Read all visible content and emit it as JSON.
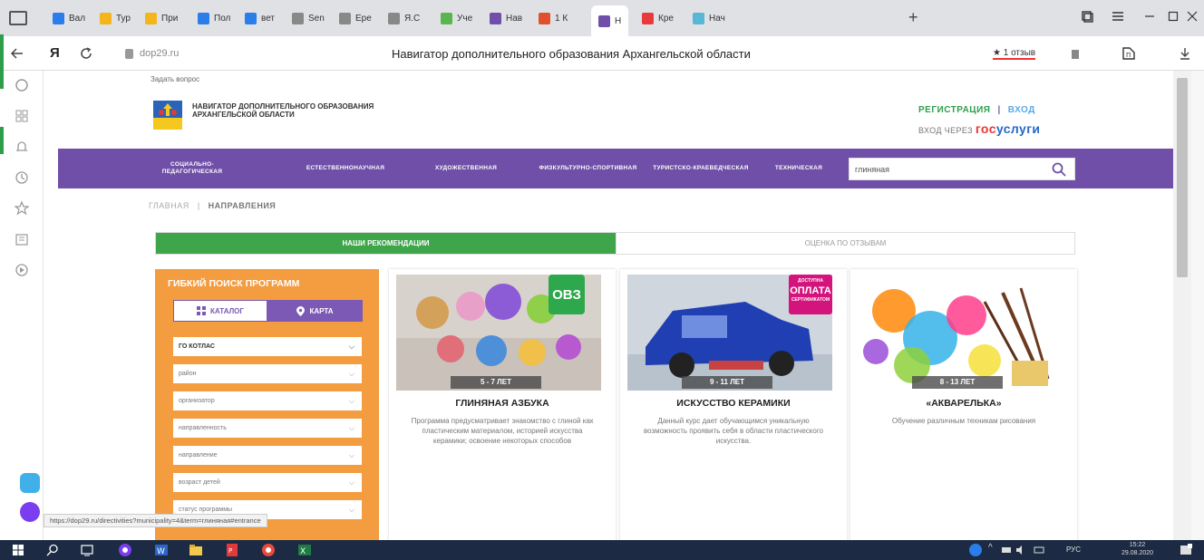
{
  "browser": {
    "tabs": [
      {
        "label": "Вал",
        "color": "#2b7de9"
      },
      {
        "label": "Тур",
        "color": "#f3b51b"
      },
      {
        "label": "При",
        "color": "#f3b51b"
      },
      {
        "label": "Пол",
        "color": "#2b7de9"
      },
      {
        "label": "вет",
        "color": "#2b7de9"
      },
      {
        "label": "Sen",
        "color": "#888888"
      },
      {
        "label": "Ере",
        "color": "#888888"
      },
      {
        "label": "Я.С",
        "color": "#888888"
      },
      {
        "label": "Уче",
        "color": "#59b64e"
      },
      {
        "label": "Нав",
        "color": "#6f4fa7"
      },
      {
        "label": "1 К",
        "color": "#e0502f"
      },
      {
        "label": "Н",
        "color": "#6f4fa7"
      },
      {
        "label": "Кре",
        "color": "#e83a3a"
      },
      {
        "label": "Нач",
        "color": "#58b7d7"
      }
    ],
    "new_tab": "+",
    "url": "dop29.ru",
    "page_title": "Навигатор дополнительного образования Архангельской области",
    "reviews_label": "★ 1 отзыв",
    "status_url": "https://dop29.ru/directivities?municipality=4&term=глиняная#entrance"
  },
  "site": {
    "ask_question": "Задать вопрос",
    "logo_text": "НАВИГАТОР ДОПОЛНИТЕЛЬНОГО ОБРАЗОВАНИЯ АРХАНГЕЛЬСКОЙ ОБЛАСТИ",
    "register": "РЕГИСТРАЦИЯ",
    "login": "ВХОД",
    "separator": "|",
    "gosuslugi_prefix": "ВХОД ЧЕРЕЗ",
    "gosuslugi_gos": "гос",
    "gosuslugi_uslugi": "услуги",
    "menu": [
      "СОЦИАЛЬНО-ПЕДАГОГИЧЕСКАЯ",
      "ЕСТЕСТВЕННОНАУЧНАЯ",
      "ХУДОЖЕСТВЕННАЯ",
      "ФИЗКУЛЬТУРНО-СПОРТИВНАЯ",
      "ТУРИСТСКО-КРАЕВЕДЧЕСКАЯ",
      "ТЕХНИЧЕСКАЯ"
    ],
    "search_value": "глиняная",
    "breadcrumb": {
      "home": "ГЛАВНАЯ",
      "sep": "|",
      "current": "НАПРАВЛЕНИЯ"
    },
    "tabs": {
      "recommend": "НАШИ РЕКОМЕНДАЦИИ",
      "rating": "ОЦЕНКА ПО ОТЗЫВАМ"
    },
    "filter": {
      "title": "ГИБКИЙ ПОИСК ПРОГРАММ",
      "catalog": "КАТАЛОГ",
      "map": "КАРТА",
      "selects": [
        "ГО КОТЛАС",
        "район",
        "организатор",
        "направленность",
        "направление",
        "возраст детей",
        "статус программы"
      ]
    },
    "cards": [
      {
        "age": "5 - 7 ЛЕТ",
        "title": "ГЛИНЯНАЯ АЗБУКА",
        "desc": "Программа предусматривает знакомство с глиной как пластическим материалом, историей искусства керамики; освоение некоторых способов",
        "badge": "ОВЗ"
      },
      {
        "age": "9 - 11 ЛЕТ",
        "title": "ИСКУССТВО КЕРАМИКИ",
        "desc": "Данный курс дает обучающимся уникальную возможность проявить себя в области пластического искусства.",
        "badge_small": "ДОСТУПНА",
        "badge_big": "ОПЛАТА",
        "badge_small2": "СЕРТИФИКАТОМ"
      },
      {
        "age": "8 - 13 ЛЕТ",
        "title": "«АКВАРЕЛЬКА»",
        "desc": "Обучение различным техникам рисования"
      }
    ]
  },
  "taskbar": {
    "lang": "РУС",
    "time": "15:22",
    "date": "29.08.2020"
  },
  "colors": {
    "purple": "#6f4fa7",
    "green": "#3fa54a",
    "orange": "#f39c40",
    "magenta": "#d4147d"
  }
}
